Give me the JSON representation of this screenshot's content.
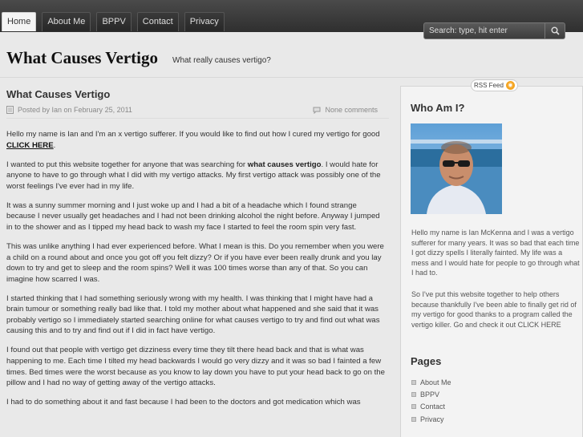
{
  "nav": {
    "tabs": [
      {
        "label": "Home",
        "active": true
      },
      {
        "label": "About Me",
        "active": false
      },
      {
        "label": "BPPV",
        "active": false
      },
      {
        "label": "Contact",
        "active": false
      },
      {
        "label": "Privacy",
        "active": false
      }
    ]
  },
  "search": {
    "placeholder": "Search: type, hit enter",
    "icon": "search-icon"
  },
  "site": {
    "title": "What Causes Vertigo",
    "tagline": "What really causes vertigo?"
  },
  "post": {
    "title": "What Causes Vertigo",
    "meta": "Posted by Ian on February 25, 2011",
    "comments": "None comments",
    "paragraphs": [
      {
        "before": "Hello my name is Ian and I'm an x vertigo sufferer. If you would like to find out how I cured my vertigo for good ",
        "link": "CLICK HERE",
        "after": "."
      },
      {
        "before": "I wanted to put this website together for anyone that was searching for ",
        "bold": "what causes vertigo",
        "after": ". I would hate for anyone to have to go through what I did with my vertigo attacks. My first vertigo attack was possibly one of the worst feelings I've ever had in my life."
      },
      {
        "text": "It was a sunny summer morning and I just woke up and I had a bit of a headache which I found strange because I never usually get headaches and I had not been drinking alcohol the night before. Anyway I jumped in to the shower and as I tipped my head back to wash my face I started to feel the room spin very fast."
      },
      {
        "text": "This was unlike anything I had ever experienced before. What I mean is this. Do you remember when you were a child on a round about and once you got off you felt dizzy? Or if you have ever been really drunk and you lay down to try and get to sleep and the room spins? Well it was 100 times worse than any of that. So you can imagine how scarred I was."
      },
      {
        "text": "I started thinking that I had something seriously wrong with my health. I was thinking that I might have had a brain tumour or something really bad like that. I told my mother about what happened and she said that it was probably vertigo so I immediately started searching online for what causes vertigo to try and find out what was causing this and to try and find out if I did in fact have vertigo."
      },
      {
        "text": "I found out that people with vertigo get dizziness every time they tilt there head back and that is what was happening to me. Each time I tilted my head backwards I would go very dizzy and it was so bad I fainted a few times. Bed times were the worst because as you know to lay down you have to put your head back to go on the pillow and I had no way of getting away of the vertigo attacks."
      },
      {
        "text": "I had to do something about it and fast because I had been to the doctors and got medication which was"
      }
    ]
  },
  "sidebar": {
    "rss_label": "RSS Feed",
    "whoami_heading": "Who Am I?",
    "bio1": "Hello my name is Ian McKenna and I was a vertigo sufferer for many years. It was so bad that each time I got dizzy spells I literally fainted. My life was a mess and I would hate for people to go through what I had to.",
    "bio2_text": "So I've put this website together to help others because thankfully I've been able to finally get rid of my vertigo for good thanks to a program called the vertigo killer. Go and check it out ",
    "bio2_link": "CLICK HERE",
    "pages_heading": "Pages",
    "pages": [
      "About Me",
      "BPPV",
      "Contact",
      "Privacy"
    ]
  },
  "colors": {
    "topbar": "#2f2f2f",
    "background": "#e9e9e9",
    "rss": "#f5a623"
  }
}
